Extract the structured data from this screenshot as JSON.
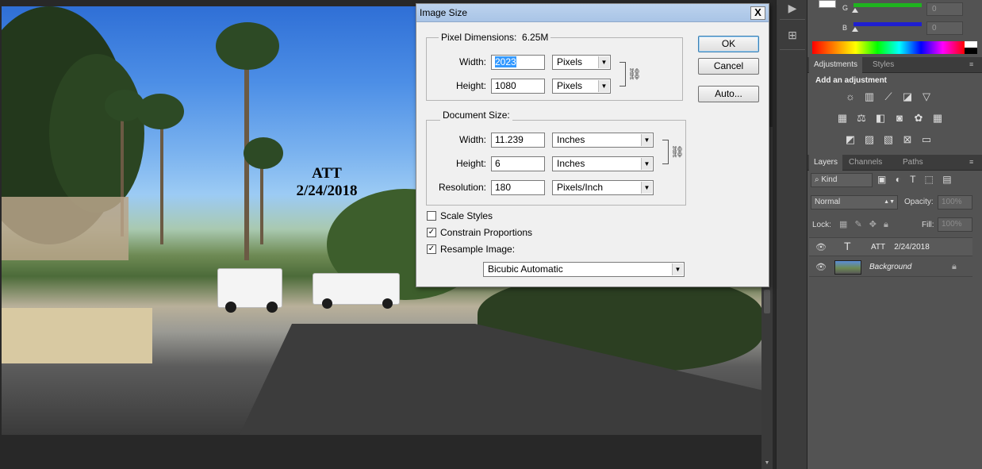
{
  "photo": {
    "caption_line1": "ATT",
    "caption_line2": "2/24/2018"
  },
  "color_panel": {
    "g_label": "G",
    "b_label": "B",
    "g_value": "0",
    "b_value": "0",
    "r_value": "0",
    "colors": {
      "g_slider": "#1fb31f",
      "b_slider": "#1f1fd0"
    }
  },
  "adjustments_panel": {
    "tabs": [
      "Adjustments",
      "Styles"
    ],
    "heading": "Add an adjustment",
    "icons_row1": [
      "brightness-icon",
      "levels-icon",
      "curves-icon",
      "exposure-icon",
      "vibrance-icon"
    ],
    "icons_row2": [
      "hue-saturation-icon",
      "color-balance-icon",
      "black-white-icon",
      "photo-filter-icon",
      "channel-mixer-icon",
      "color-lookup-icon"
    ],
    "icons_row3": [
      "invert-icon",
      "posterize-icon",
      "threshold-icon",
      "selective-color-icon",
      "gradient-map-icon"
    ]
  },
  "layers_panel": {
    "tabs": [
      "Layers",
      "Channels",
      "Paths"
    ],
    "filter_label": "Kind",
    "blend_mode": "Normal",
    "opacity_label": "Opacity:",
    "opacity_value": "100%",
    "lock_label": "Lock:",
    "fill_label": "Fill:",
    "fill_value": "100%",
    "layers": [
      {
        "type": "text",
        "name_prefix": "ATT",
        "name_suffix": "2/24/2018"
      },
      {
        "type": "image",
        "name": "Background",
        "locked": true
      }
    ]
  },
  "dialog": {
    "title": "Image Size",
    "close": "X",
    "pixel_dimensions": {
      "legend": "Pixel Dimensions:",
      "size": "6.25M",
      "width_label": "Width:",
      "width_value": "2023",
      "width_unit": "Pixels",
      "height_label": "Height:",
      "height_value": "1080",
      "height_unit": "Pixels"
    },
    "document_size": {
      "legend": "Document Size:",
      "width_label": "Width:",
      "width_value": "11.239",
      "width_unit": "Inches",
      "height_label": "Height:",
      "height_value": "6",
      "height_unit": "Inches",
      "resolution_label": "Resolution:",
      "resolution_value": "180",
      "resolution_unit": "Pixels/Inch"
    },
    "options": {
      "scale_styles": {
        "label": "Scale Styles",
        "checked": false
      },
      "constrain_proportions": {
        "label": "Constrain Proportions",
        "checked": true
      },
      "resample_image": {
        "label": "Resample Image:",
        "checked": true
      },
      "resample_method": "Bicubic Automatic"
    },
    "buttons": {
      "ok": "OK",
      "cancel": "Cancel",
      "auto": "Auto..."
    }
  }
}
